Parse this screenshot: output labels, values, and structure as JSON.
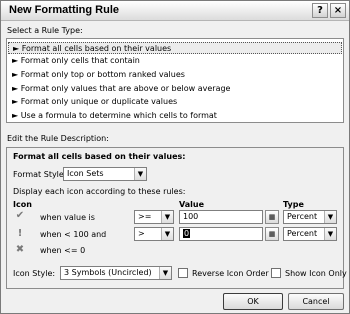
{
  "window": {
    "title": "New Formatting Rule",
    "help_label": "?",
    "close_label": "×"
  },
  "rule_type": {
    "label": "Select a Rule Type:",
    "items": [
      "► Format all cells based on their values",
      "► Format only cells that contain",
      "► Format only top or bottom ranked values",
      "► Format only values that are above or below average",
      "► Format only unique or duplicate values",
      "► Use a formula to determine which cells to format"
    ],
    "selected_index": 0
  },
  "description": {
    "label": "Edit the Rule Description:",
    "heading": "Format all cells based on their values:",
    "format_style_label": "Format Style:",
    "format_style_value": "Icon Sets",
    "display_rule_text": "Display each icon according to these rules:",
    "col_icon": "Icon",
    "col_value": "Value",
    "col_type": "Type",
    "rows": [
      {
        "icon": "check-icon",
        "condition": "when value is",
        "operator": ">=",
        "value": "100",
        "type": "Percent"
      },
      {
        "icon": "exclamation-icon",
        "condition": "when < 100 and",
        "operator": ">",
        "value": "0",
        "type": "Percent"
      },
      {
        "icon": "x-icon",
        "condition": "when <= 0"
      }
    ],
    "icon_style_label": "Icon Style:",
    "icon_style_value": "3 Symbols (Uncircled)",
    "reverse_label": "Reverse Icon Order",
    "show_icon_only_label": "Show Icon Only"
  },
  "buttons": {
    "ok": "OK",
    "cancel": "Cancel"
  }
}
